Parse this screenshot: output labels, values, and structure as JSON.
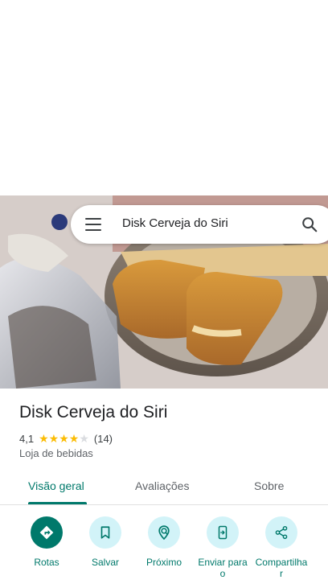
{
  "search": {
    "query": "Disk Cerveja do Siri"
  },
  "place": {
    "name": "Disk Cerveja do Siri",
    "rating": "4,1",
    "rating_stars": 4.1,
    "review_count": "(14)",
    "category": "Loja de bebidas"
  },
  "tabs": [
    {
      "label": "Visão geral",
      "active": true
    },
    {
      "label": "Avaliações",
      "active": false
    },
    {
      "label": "Sobre",
      "active": false
    }
  ],
  "actions": [
    {
      "label": "Rotas",
      "icon": "directions-icon"
    },
    {
      "label": "Salvar",
      "icon": "bookmark-icon"
    },
    {
      "label": "Próximo",
      "icon": "nearby-icon"
    },
    {
      "label": "Enviar para o",
      "icon": "send-to-phone-icon"
    },
    {
      "label": "Compartilha r",
      "icon": "share-icon"
    }
  ],
  "colors": {
    "accent": "#00796b",
    "action_bg": "#d2f3f8",
    "star": "#fbbc04"
  }
}
